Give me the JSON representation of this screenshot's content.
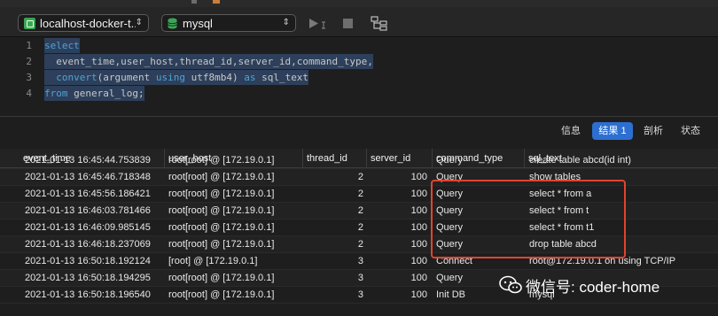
{
  "toolbar": {
    "connection": "localhost-docker-t...",
    "database": "mysql"
  },
  "editor": {
    "line_numbers": [
      "1",
      "2",
      "3",
      "4"
    ],
    "lines": [
      [
        {
          "t": "select",
          "c": "kw"
        }
      ],
      [
        {
          "t": "  event_time,user_host,thread_id,server_id,command_type,",
          "c": "plain"
        }
      ],
      [
        {
          "t": "  ",
          "c": "plain"
        },
        {
          "t": "convert",
          "c": "fn"
        },
        {
          "t": "(argument ",
          "c": "plain"
        },
        {
          "t": "using",
          "c": "kw"
        },
        {
          "t": " utf8mb4) ",
          "c": "plain"
        },
        {
          "t": "as",
          "c": "kw"
        },
        {
          "t": " sql_text",
          "c": "plain"
        }
      ],
      [
        {
          "t": "from",
          "c": "kw"
        },
        {
          "t": " general_log;",
          "c": "plain"
        }
      ]
    ]
  },
  "tabs": {
    "info": "信息",
    "result1": "结果 1",
    "profile": "剖析",
    "status": "状态"
  },
  "columns": [
    "event_time",
    "user_host",
    "thread_id",
    "server_id",
    "command_type",
    "sql_text"
  ],
  "partial_row": {
    "event_time": "2021-01-13 16:45:44.753839",
    "user_host": "root[root] @  [172.19.0.1]",
    "command_type": "Query",
    "sql_text": "create table abcd(id int)"
  },
  "rows": [
    {
      "event_time": "2021-01-13 16:45:46.718348",
      "user_host": "root[root] @  [172.19.0.1]",
      "thread_id": "2",
      "server_id": "100",
      "command_type": "Query",
      "sql_text": "show tables"
    },
    {
      "event_time": "2021-01-13 16:45:56.186421",
      "user_host": "root[root] @  [172.19.0.1]",
      "thread_id": "2",
      "server_id": "100",
      "command_type": "Query",
      "sql_text": "select * from a"
    },
    {
      "event_time": "2021-01-13 16:46:03.781466",
      "user_host": "root[root] @  [172.19.0.1]",
      "thread_id": "2",
      "server_id": "100",
      "command_type": "Query",
      "sql_text": "select * from t"
    },
    {
      "event_time": "2021-01-13 16:46:09.985145",
      "user_host": "root[root] @  [172.19.0.1]",
      "thread_id": "2",
      "server_id": "100",
      "command_type": "Query",
      "sql_text": "select * from t1"
    },
    {
      "event_time": "2021-01-13 16:46:18.237069",
      "user_host": "root[root] @  [172.19.0.1]",
      "thread_id": "2",
      "server_id": "100",
      "command_type": "Query",
      "sql_text": "drop table abcd"
    },
    {
      "event_time": "2021-01-13 16:50:18.192124",
      "user_host": "[root] @  [172.19.0.1]",
      "thread_id": "3",
      "server_id": "100",
      "command_type": "Connect",
      "sql_text": "root@172.19.0.1 on  using TCP/IP"
    },
    {
      "event_time": "2021-01-13 16:50:18.194295",
      "user_host": "root[root] @  [172.19.0.1]",
      "thread_id": "3",
      "server_id": "100",
      "command_type": "Query",
      "sql_text": ""
    },
    {
      "event_time": "2021-01-13 16:50:18.196540",
      "user_host": "root[root] @  [172.19.0.1]",
      "thread_id": "3",
      "server_id": "100",
      "command_type": "Init DB",
      "sql_text": "mysql"
    }
  ],
  "watermark": "微信号: coder-home",
  "colors": {
    "accent": "#2c6fd1",
    "highlight_box": "#e0442f",
    "keyword": "#4fa3d8",
    "connection_icon": "#3aa655",
    "selection": "#2d3f5a"
  },
  "icons": [
    "connection-icon",
    "database-icon",
    "run-icon",
    "stop-icon",
    "explain-icon",
    "chevron-updown-icon",
    "wechat-icon"
  ]
}
